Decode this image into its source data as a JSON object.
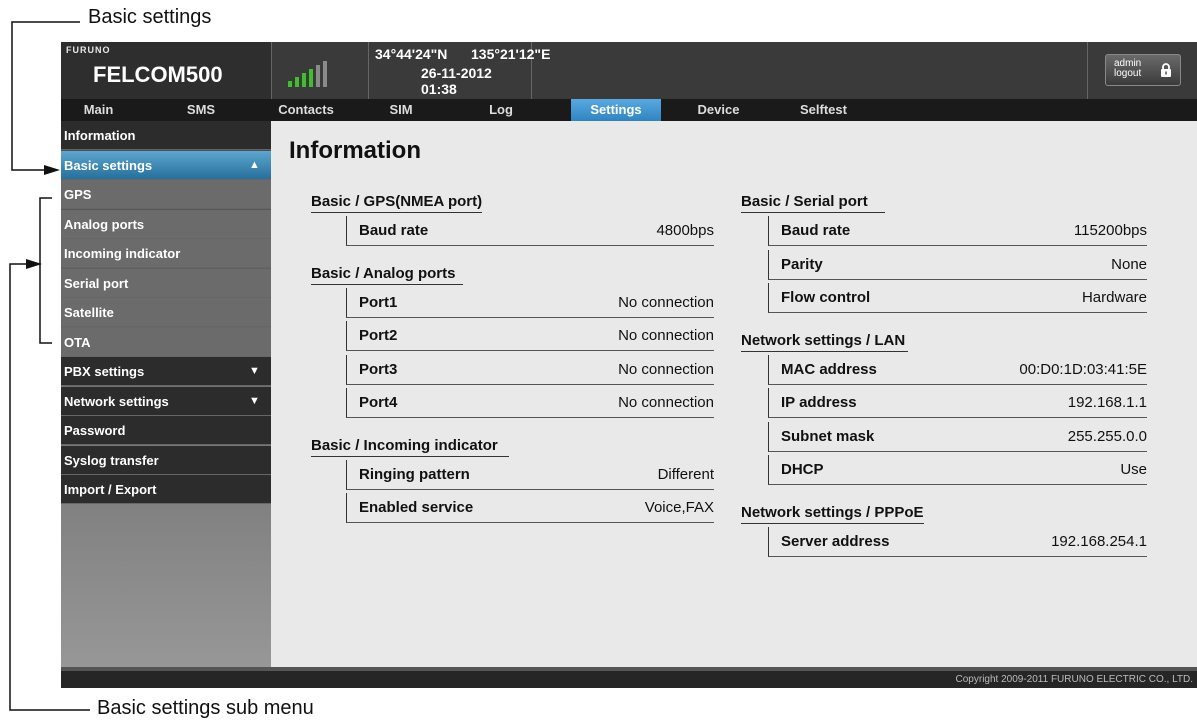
{
  "annotations": {
    "top": "Basic settings",
    "bottom": "Basic settings sub menu"
  },
  "header": {
    "brand": "FURUNO",
    "product": "FELCOM500",
    "latitude": "34°44'24\"N",
    "longitude": "135°21'12\"E",
    "datetime": "26-11-2012 01:38",
    "signal_bars_lit": 4,
    "signal_bars_total": 6,
    "admin_line1": "admin",
    "admin_line2": "logout"
  },
  "nav": {
    "tabs": [
      "Main",
      "SMS",
      "Contacts",
      "SIM",
      "Log",
      "Settings",
      "Device",
      "Selftest"
    ],
    "active": "Settings"
  },
  "sidebar": {
    "items": [
      {
        "label": "Information"
      },
      {
        "label": "Basic settings",
        "arrow": "▲"
      },
      {
        "label": "GPS"
      },
      {
        "label": "Analog ports"
      },
      {
        "label": "Incoming indicator"
      },
      {
        "label": "Serial port"
      },
      {
        "label": "Satellite"
      },
      {
        "label": "OTA"
      },
      {
        "label": "PBX settings",
        "arrow": "▼"
      },
      {
        "label": "Network settings",
        "arrow": "▼"
      },
      {
        "label": "Password"
      },
      {
        "label": "Syslog transfer"
      },
      {
        "label": "Import / Export"
      }
    ]
  },
  "main": {
    "title": "Information",
    "left": [
      {
        "title": "Basic / GPS(NMEA port)",
        "rows": [
          {
            "k": "Baud rate",
            "v": "4800bps"
          }
        ]
      },
      {
        "title": "Basic / Analog ports",
        "rows": [
          {
            "k": "Port1",
            "v": "No connection"
          },
          {
            "k": "Port2",
            "v": "No connection"
          },
          {
            "k": "Port3",
            "v": "No connection"
          },
          {
            "k": "Port4",
            "v": "No connection"
          }
        ]
      },
      {
        "title": "Basic / Incoming indicator",
        "rows": [
          {
            "k": "Ringing pattern",
            "v": "Different"
          },
          {
            "k": "Enabled service",
            "v": "Voice,FAX"
          }
        ]
      }
    ],
    "right": [
      {
        "title": "Basic / Serial port",
        "rows": [
          {
            "k": "Baud rate",
            "v": "115200bps"
          },
          {
            "k": "Parity",
            "v": "None"
          },
          {
            "k": "Flow control",
            "v": "Hardware"
          }
        ]
      },
      {
        "title": "Network settings / LAN",
        "rows": [
          {
            "k": "MAC address",
            "v": "00:D0:1D:03:41:5E"
          },
          {
            "k": "IP address",
            "v": "192.168.1.1"
          },
          {
            "k": "Subnet mask",
            "v": "255.255.0.0"
          },
          {
            "k": "DHCP",
            "v": "Use"
          }
        ]
      },
      {
        "title": "Network settings / PPPoE",
        "rows": [
          {
            "k": "Server address",
            "v": "192.168.254.1"
          }
        ]
      }
    ]
  },
  "footer": {
    "copyright": "Copyright 2009-2011 FURUNO ELECTRIC CO., LTD."
  }
}
